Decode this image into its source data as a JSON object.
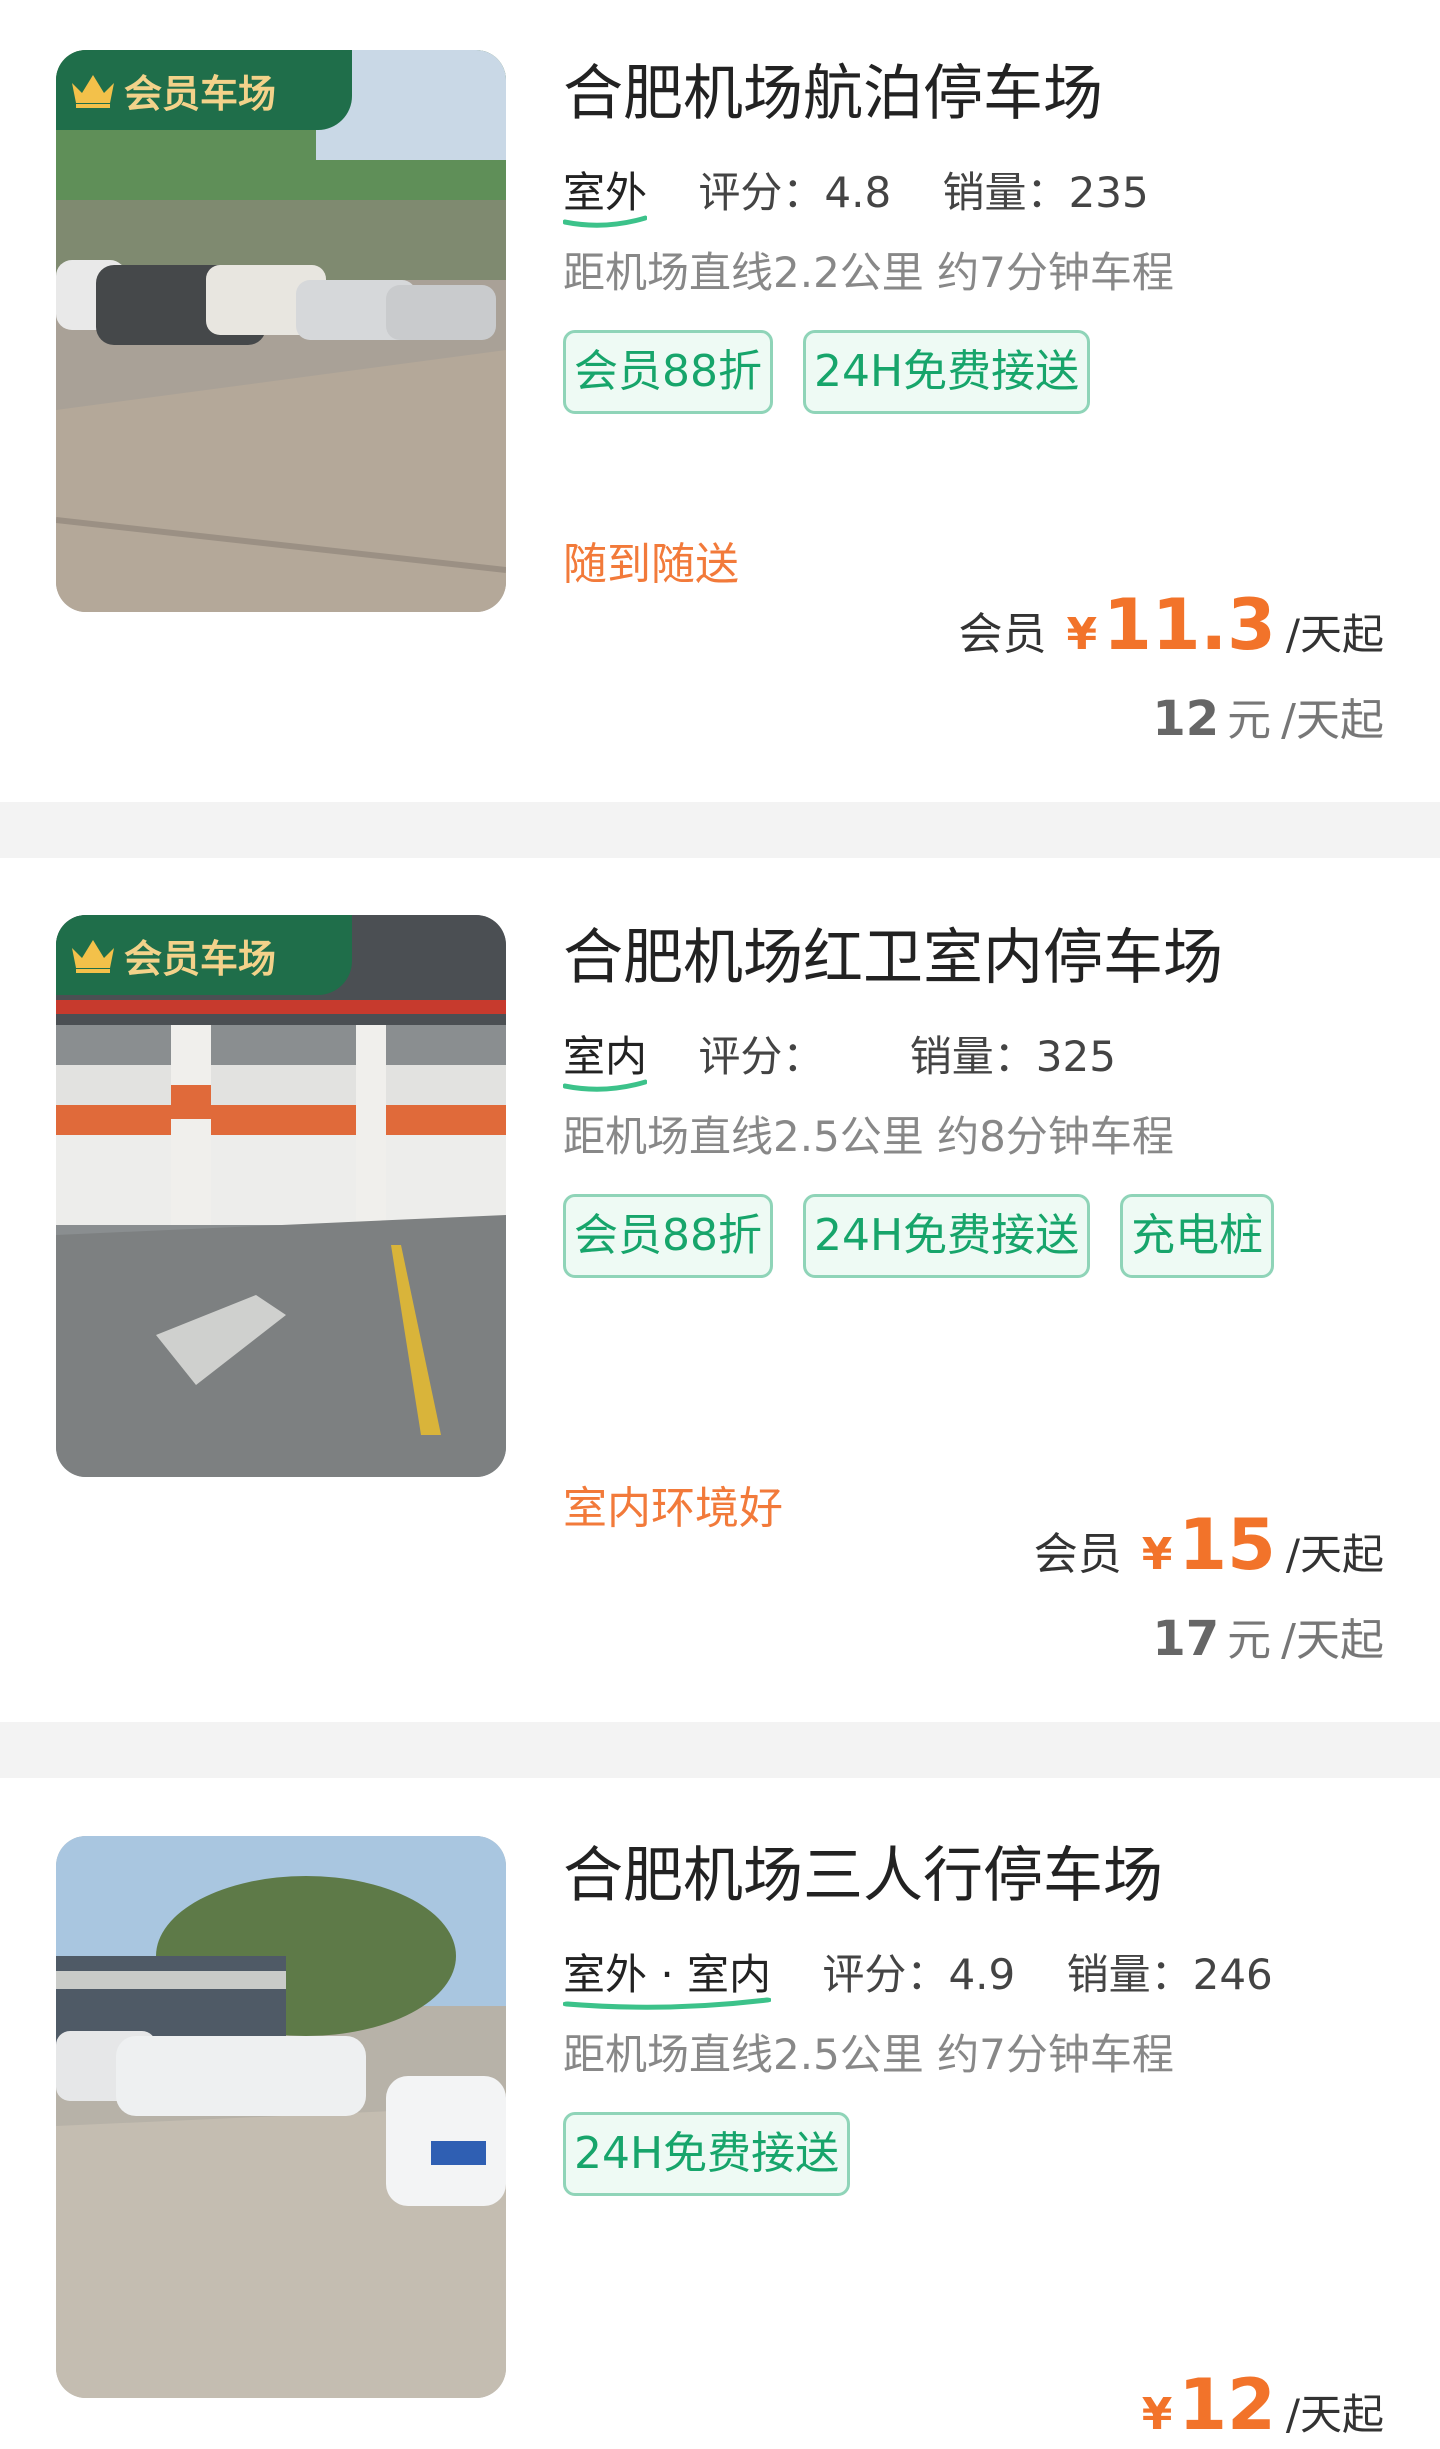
{
  "badge_label": "会员车场",
  "lots": [
    {
      "name": "合肥机场航泊停车场",
      "type": "室外",
      "rating_label": "评分：",
      "rating": "4.8",
      "sales_label": "销量：",
      "sales": "235",
      "distance": "距机场直线2.2公里 约7分钟车程",
      "tags": [
        "会员88折",
        "24H免费接送"
      ],
      "slogan": "随到随送",
      "member_label": "会员",
      "currency": "¥",
      "member_price": "11.3",
      "unit": "/天起",
      "original_price": "12",
      "original_currency": "元"
    },
    {
      "name": "合肥机场红卫室内停车场",
      "type": "室内",
      "rating_label": "评分：",
      "rating": "",
      "sales_label": "销量：",
      "sales": "325",
      "distance": "距机场直线2.5公里 约8分钟车程",
      "tags": [
        "会员88折",
        "24H免费接送",
        "充电桩"
      ],
      "slogan": "室内环境好",
      "member_label": "会员",
      "currency": "¥",
      "member_price": "15",
      "unit": "/天起",
      "original_price": "17",
      "original_currency": "元"
    },
    {
      "name": "合肥机场三人行停车场",
      "type": "室外 · 室内",
      "rating_label": "评分：",
      "rating": "4.9",
      "sales_label": "销量：",
      "sales": "246",
      "distance": "距机场直线2.5公里 约7分钟车程",
      "tags": [
        "24H免费接送"
      ],
      "currency": "¥",
      "price": "12",
      "unit": "/天起"
    }
  ],
  "colors": {
    "accent_green": "#17a56b",
    "price_orange": "#f2732a",
    "badge_green": "#1f6e4a",
    "badge_gold": "#f3d28a"
  },
  "icons": [
    "crown-icon"
  ]
}
